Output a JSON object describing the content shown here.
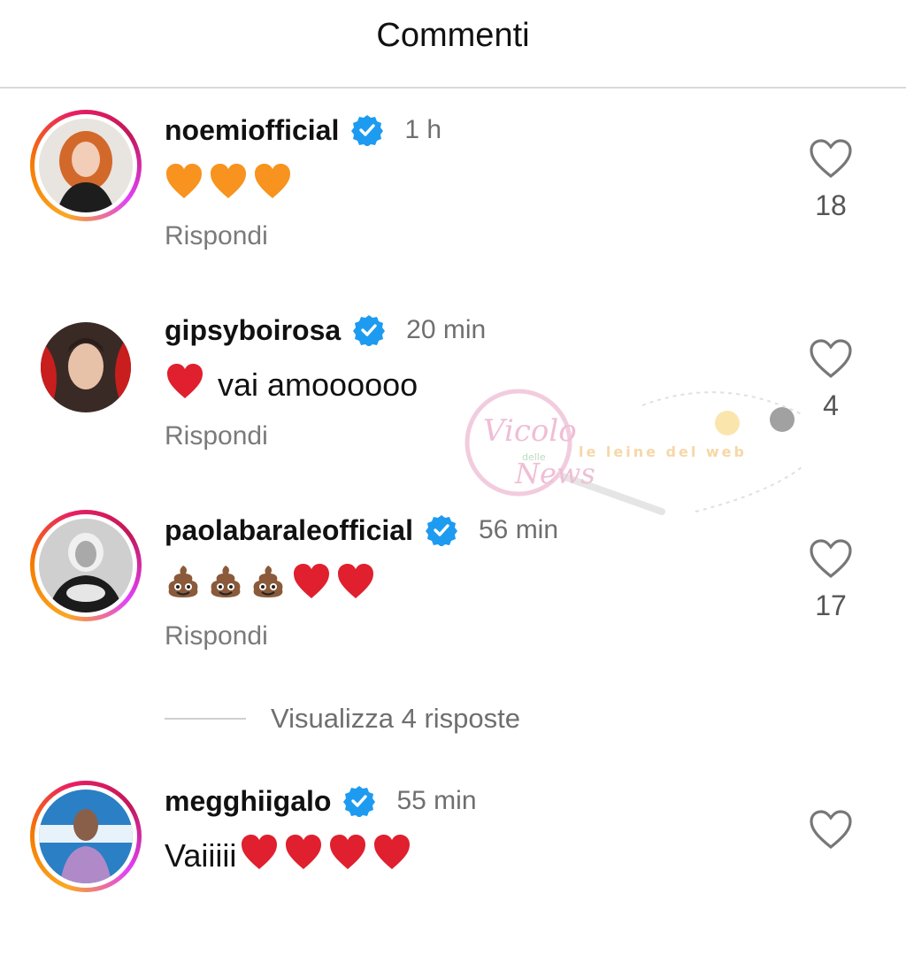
{
  "header": {
    "title": "Commenti"
  },
  "comments": [
    {
      "username": "noemiofficial",
      "time": "1 h",
      "text": "",
      "emojis": [
        "orange-heart",
        "orange-heart",
        "orange-heart"
      ],
      "reply_label": "Rispondi",
      "likes": "18"
    },
    {
      "username": "gipsyboirosa",
      "time": "20 min",
      "text": "vai amoooooo",
      "emojis": [
        "red-heart"
      ],
      "reply_label": "Rispondi",
      "likes": "4"
    },
    {
      "username": "paolabaraleofficial",
      "time": "56 min",
      "text": "",
      "emojis": [
        "poop",
        "poop",
        "poop",
        "red-heart",
        "red-heart"
      ],
      "reply_label": "Rispondi",
      "likes": "17"
    },
    {
      "username": "megghiigalo",
      "time": "55 min",
      "text": "Vaiiiii",
      "emojis": [
        "red-heart",
        "red-heart",
        "red-heart",
        "red-heart"
      ],
      "reply_label": "",
      "likes": ""
    }
  ],
  "view_replies": {
    "label": "Visualizza 4 risposte"
  },
  "watermark": {
    "text1": "Vicolo",
    "text2": "delle",
    "text3": "News",
    "text4": "le leine del web"
  },
  "colors": {
    "verified": "#1d9bf0",
    "orange_heart": "#f7931e",
    "red_heart": "#e0202e",
    "muted_text": "#7a7a7a"
  },
  "icons": {
    "like": "heart-outline-icon",
    "verified": "verified-badge-icon"
  }
}
